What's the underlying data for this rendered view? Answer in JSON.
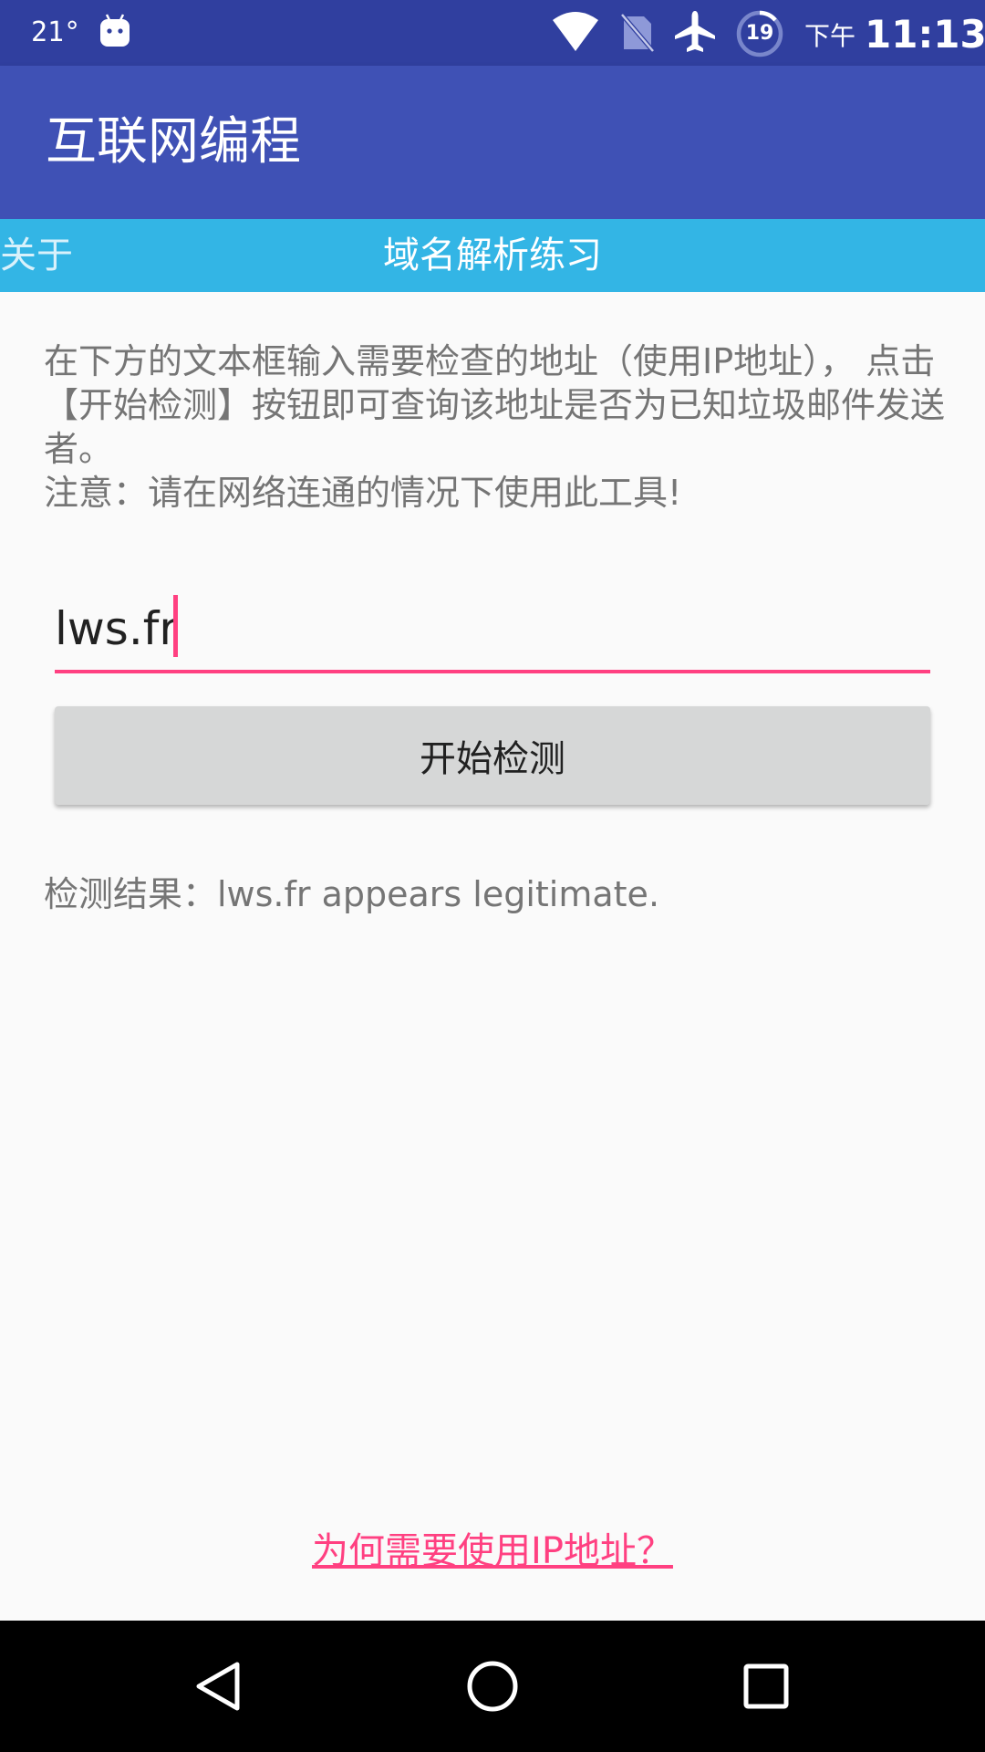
{
  "status_bar": {
    "temperature": "21°",
    "ampm": "下午",
    "time": "11:13",
    "battery_level": "19"
  },
  "app_bar": {
    "title": "互联网编程"
  },
  "sub_header": {
    "about_label": "关于",
    "title": "域名解析练习"
  },
  "instructions": {
    "line1": "在下方的文本框输入需要检查的地址（使用IP地址），  点击【开始检测】按钮即可查询该地址是否为已知垃圾邮件发送者。",
    "line2": "注意：请在网络连通的情况下使用此工具!"
  },
  "domain_input": {
    "value": "lws.fr"
  },
  "check_button": {
    "label": "开始检测"
  },
  "result": {
    "text": "检测结果：lws.fr appears legitimate."
  },
  "footer": {
    "why_ip_link": "为何需要使用IP地址？"
  },
  "colors": {
    "status_bar": "#303f9f",
    "app_bar": "#3f51b5",
    "sub_header": "#33b5e5",
    "accent": "#ff4081",
    "button": "#d6d7d7"
  },
  "icons": [
    "android-icon",
    "wifi-icon",
    "no-sim-icon",
    "airplane-mode-icon",
    "battery-icon",
    "back-icon",
    "home-icon",
    "recents-icon"
  ]
}
